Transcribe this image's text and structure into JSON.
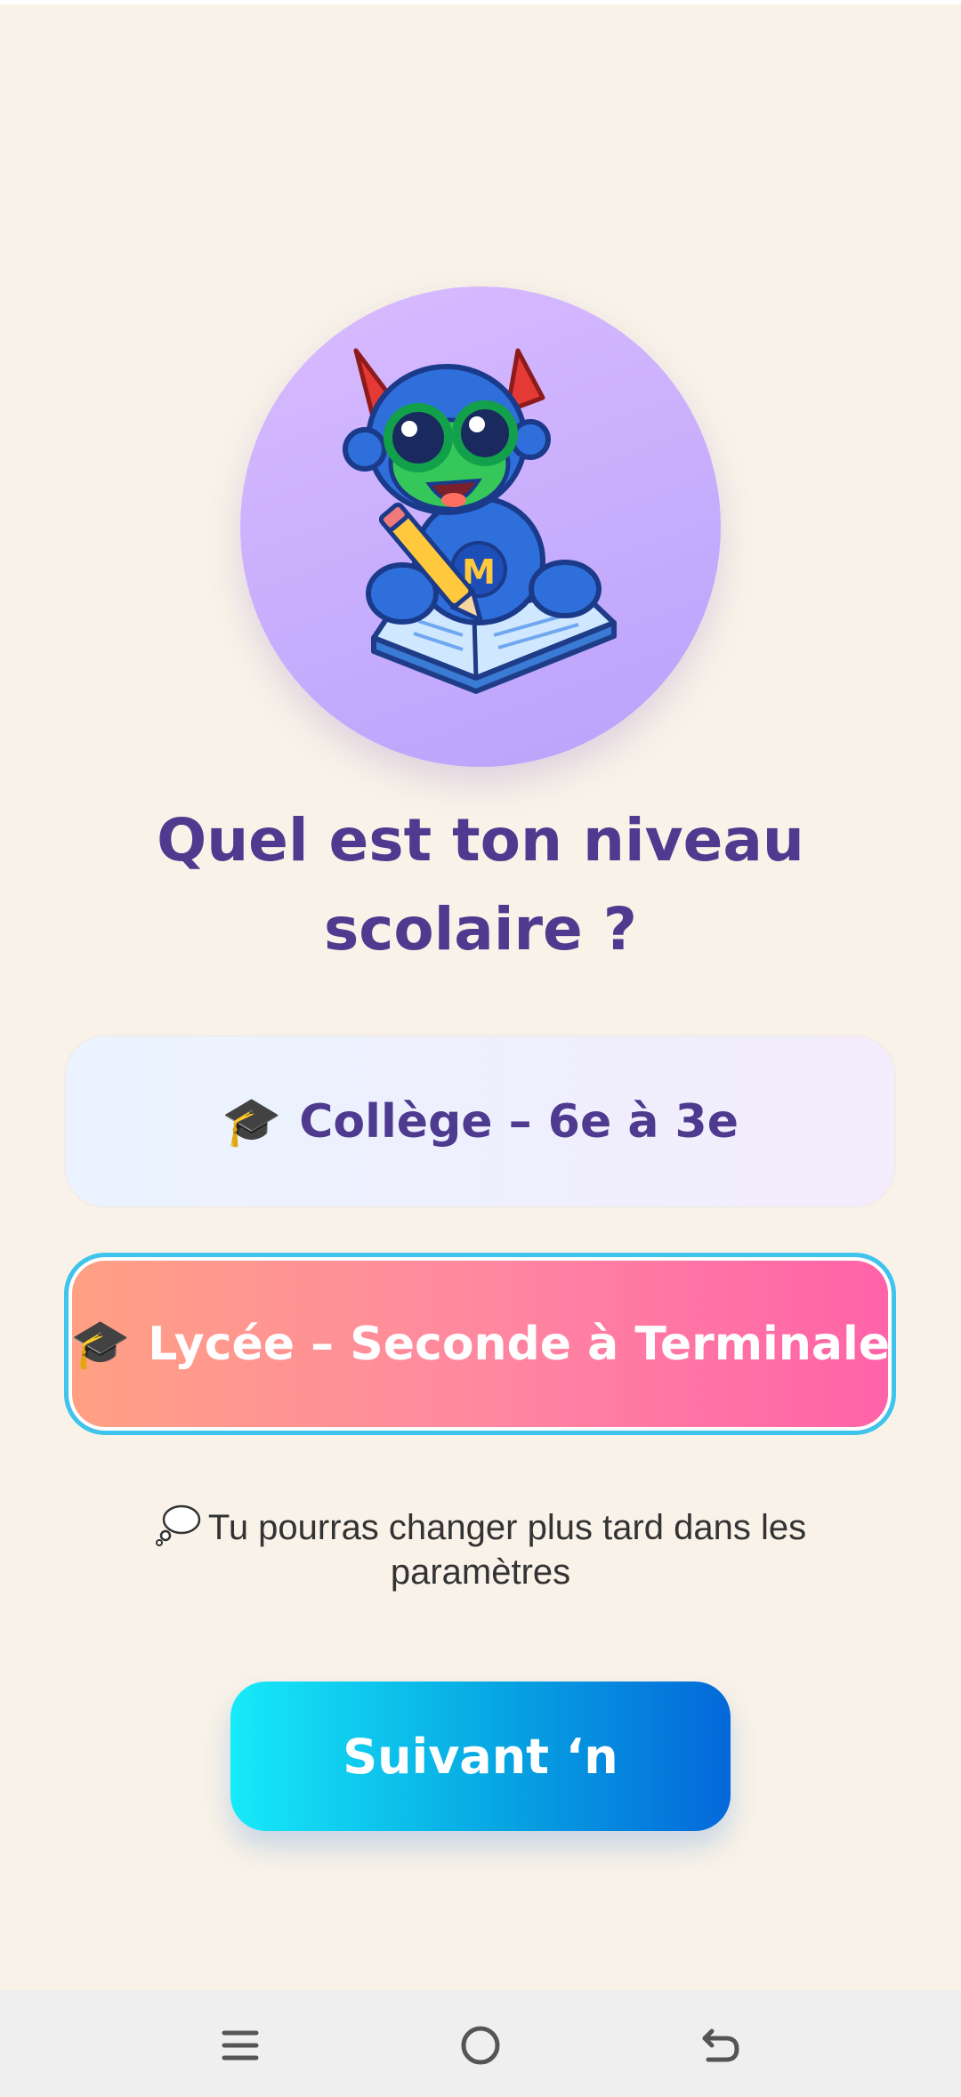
{
  "question": {
    "title": "Quel est ton niveau scolaire ?"
  },
  "options": [
    {
      "icon": "graduation-cap-icon",
      "emoji": "🎓",
      "label": "Collège – 6e à 3e",
      "selected": false
    },
    {
      "icon": "graduation-cap-icon",
      "emoji": "🎓",
      "label": "Lycée – Seconde à Terminale",
      "selected": true
    }
  ],
  "hint": {
    "icon": "thought-bubble-icon",
    "text": "Tu pourras changer plus tard dans les paramètres"
  },
  "next_button": {
    "label": "Suivant ‘n"
  },
  "colors": {
    "background": "#F8F2E8",
    "title": "#4E3A8F",
    "selected_border": "#3FC4EE",
    "next_gradient_start": "#17EAF8",
    "next_gradient_end": "#0468DA"
  },
  "nav_bar": {
    "buttons": [
      "menu-icon",
      "home-icon",
      "back-icon"
    ]
  }
}
